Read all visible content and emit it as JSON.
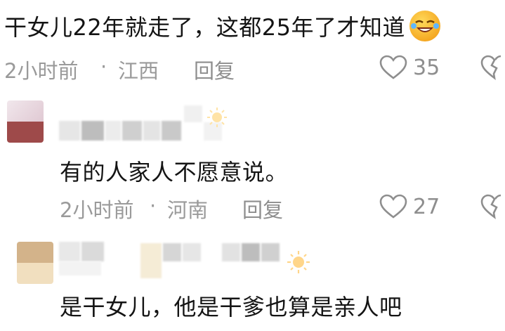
{
  "comments": [
    {
      "text": "干女儿22年就走了，这都25年了才知道",
      "emoji": "rolling-on-floor-laughing-emoji",
      "time": "2小时前",
      "separator": "·",
      "location": "江西",
      "reply_label": "回复",
      "likes": "35"
    },
    {
      "text": "有的人家人不愿意说。",
      "time": "2小时前",
      "separator": "·",
      "location": "河南",
      "reply_label": "回复",
      "likes": "27"
    },
    {
      "text": "是干女儿，他是干爹也算是亲人吧"
    }
  ],
  "colors": {
    "text": "#141414",
    "meta": "#9a9a9a",
    "icon": "#8e8e8e"
  }
}
